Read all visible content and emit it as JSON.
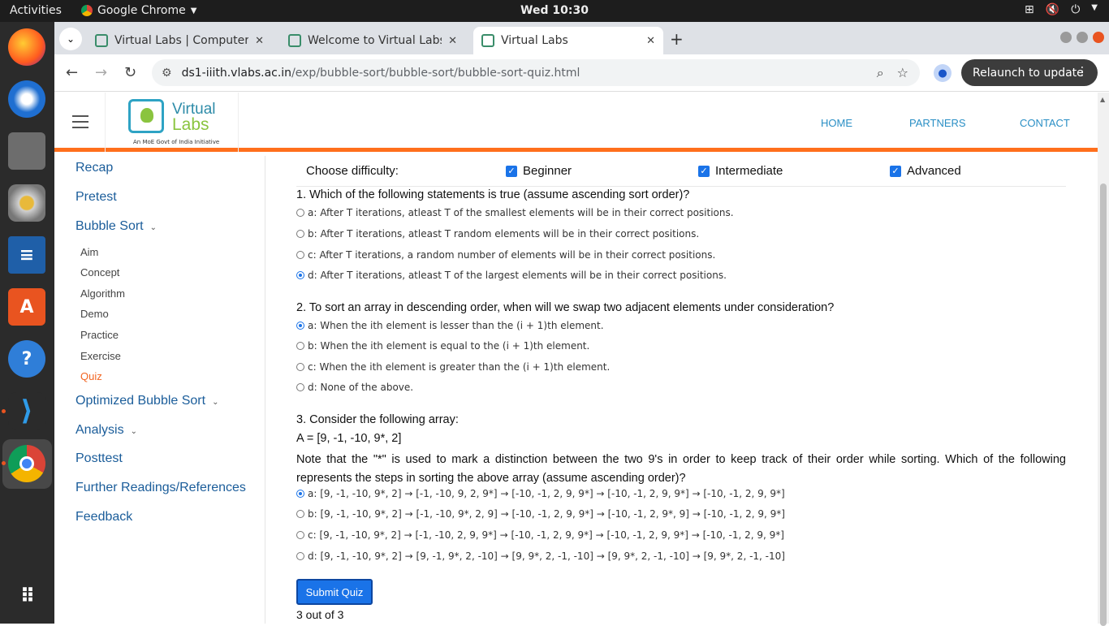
{
  "os": {
    "activities": "Activities",
    "app_name": "Google Chrome",
    "clock": "Wed 10:30"
  },
  "browser": {
    "tabs": [
      {
        "title": "Virtual Labs | Computer Science",
        "active": false
      },
      {
        "title": "Welcome to Virtual Labs",
        "active": false
      },
      {
        "title": "Virtual Labs",
        "active": true
      }
    ],
    "url_host": "ds1-iiith.vlabs.ac.in",
    "url_path": "/exp/bubble-sort/bubble-sort/bubble-sort-quiz.html",
    "relaunch_label": "Relaunch to update"
  },
  "site": {
    "logo_line1": "Virtual",
    "logo_line2": "Labs",
    "logo_tagline": "An MoE Govt of India Initiative",
    "nav": [
      "HOME",
      "PARTNERS",
      "CONTACT"
    ]
  },
  "sidebar": {
    "items": [
      {
        "label": "Recap"
      },
      {
        "label": "Pretest"
      },
      {
        "label": "Bubble Sort"
      },
      {
        "label": "Aim"
      },
      {
        "label": "Concept"
      },
      {
        "label": "Algorithm"
      },
      {
        "label": "Demo"
      },
      {
        "label": "Practice"
      },
      {
        "label": "Exercise"
      },
      {
        "label": "Quiz"
      },
      {
        "label": "Optimized Bubble Sort"
      },
      {
        "label": "Analysis"
      },
      {
        "label": "Posttest"
      },
      {
        "label": "Further Readings/References"
      },
      {
        "label": "Feedback"
      }
    ],
    "active": "Quiz"
  },
  "quiz": {
    "difficulty_label": "Choose difficulty:",
    "difficulties": [
      {
        "label": "Beginner",
        "checked": true
      },
      {
        "label": "Intermediate",
        "checked": true
      },
      {
        "label": "Advanced",
        "checked": true
      }
    ],
    "questions": [
      {
        "title": "1. Which of the following statements is true (assume ascending sort order)?",
        "selected": 3,
        "options": [
          "a: After T iterations, atleast T of the smallest elements will be in their correct positions.",
          "b: After T iterations, atleast T random elements will be in their correct positions.",
          "c: After T iterations, a random number of elements will be in their correct positions.",
          "d: After T iterations, atleast T of the largest elements will be in their correct positions."
        ]
      },
      {
        "title": "2. To sort an array in descending order, when will we swap two adjacent elements under consideration?",
        "selected": 0,
        "options": [
          "a: When the ith element is lesser than the (i + 1)th element.",
          "b: When the ith element is equal to the (i + 1)th element.",
          "c: When the ith element is greater than the (i + 1)th element.",
          "d: None of the above."
        ]
      },
      {
        "title": "3. Consider the following array:",
        "array_line": "A = [9, -1, -10, 9*, 2]",
        "note": "Note that the \"*\" is used to mark a distinction between the two 9's in order to keep track of their order while sorting. Which of the following represents the steps in sorting the above array (assume ascending order)?",
        "selected": 0,
        "options": [
          "a: [9, -1, -10, 9*, 2] → [-1, -10, 9, 2, 9*] → [-10, -1, 2, 9, 9*] → [-10, -1, 2, 9, 9*] → [-10, -1, 2, 9, 9*]",
          "b: [9, -1, -10, 9*, 2] → [-1, -10, 9*, 2, 9] → [-10, -1, 2, 9, 9*] → [-10, -1, 2, 9*, 9] → [-10, -1, 2, 9, 9*]",
          "c: [9, -1, -10, 9*, 2] → [-1, -10, 2, 9, 9*] → [-10, -1, 2, 9, 9*] → [-10, -1, 2, 9, 9*] → [-10, -1, 2, 9, 9*]",
          "d: [9, -1, -10, 9*, 2] → [9, -1, 9*, 2, -10] → [9, 9*, 2, -1, -10] → [9, 9*, 2, -1, -10] → [9, 9*, 2, -1, -10]"
        ]
      }
    ],
    "submit_label": "Submit Quiz",
    "score": "3 out of 3"
  },
  "colors": {
    "accent_orange": "#ff6f1c",
    "link_blue": "#1b5d9a",
    "button_blue": "#1a73e8"
  }
}
